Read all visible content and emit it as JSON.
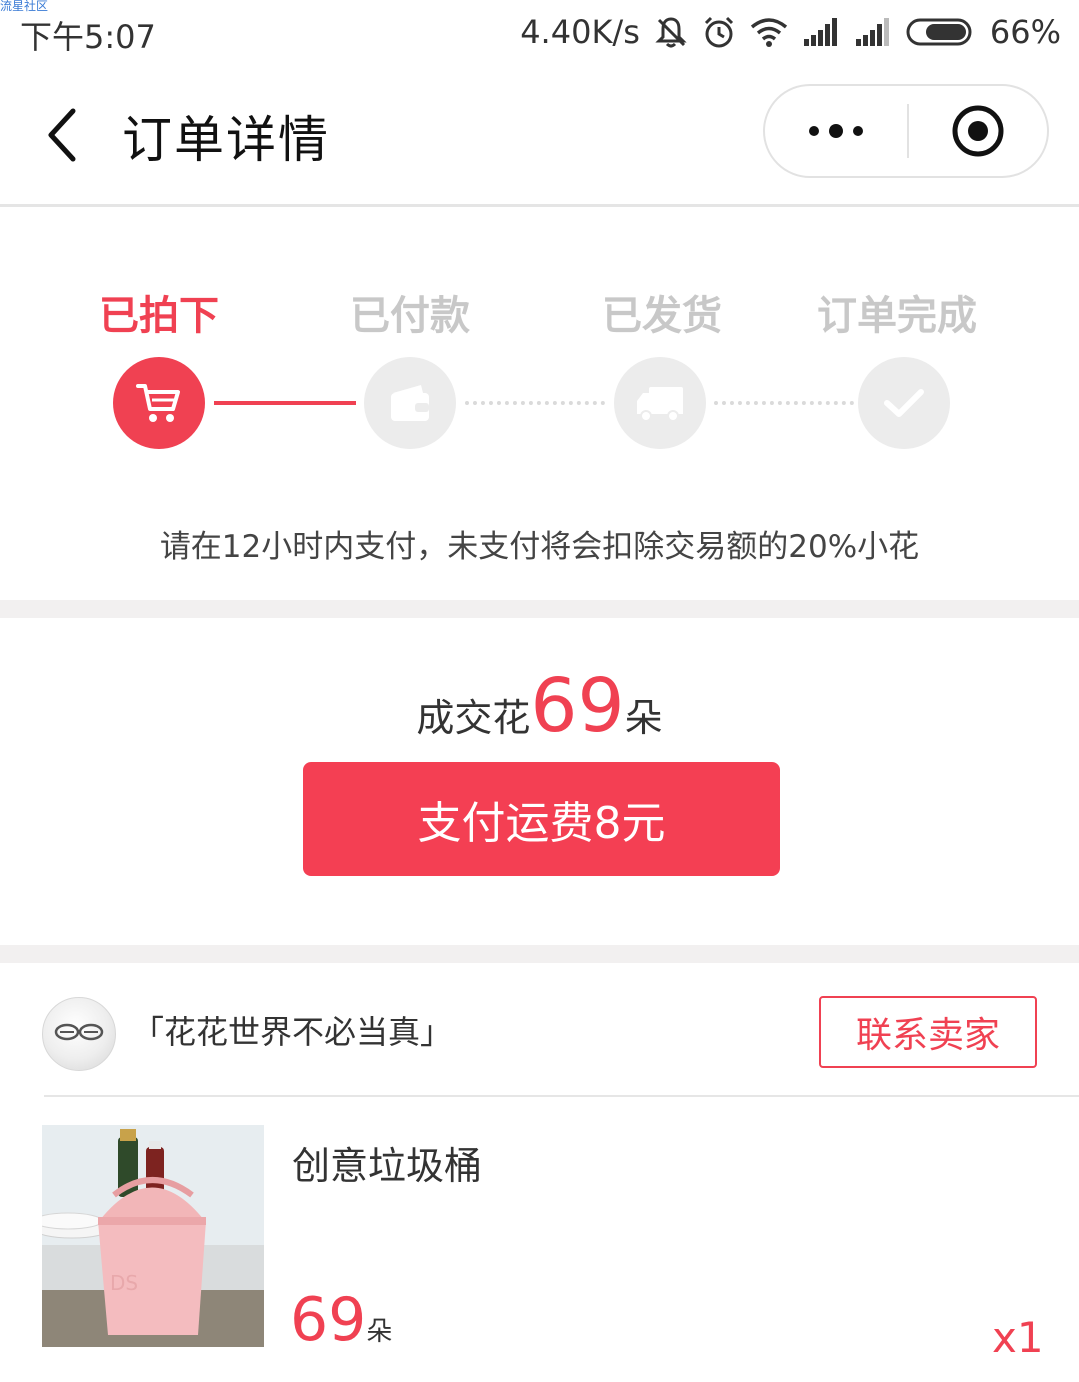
{
  "watermark": "流星社区",
  "status_bar": {
    "time": "下午5:07",
    "net_speed": "4.40K/s",
    "battery": "66%",
    "icons": [
      "mute-icon",
      "alarm-icon",
      "wifi-icon",
      "signal-icon",
      "signal-icon",
      "battery-icon"
    ]
  },
  "nav": {
    "title": "订单详情",
    "back_icon": "chevron-left-icon",
    "more_icon": "more-dots-icon",
    "close_icon": "target-icon"
  },
  "progress": {
    "current_step": 0,
    "steps": [
      {
        "label": "已拍下",
        "icon": "cart-icon"
      },
      {
        "label": "已付款",
        "icon": "wallet-icon"
      },
      {
        "label": "已发货",
        "icon": "truck-icon"
      },
      {
        "label": "订单完成",
        "icon": "check-icon"
      }
    ],
    "notice": "请在12小时内支付，未支付将会扣除交易额的20%小花"
  },
  "deal": {
    "prefix": "成交花",
    "amount": "69",
    "unit": "朵",
    "pay_button": "支付运费8元"
  },
  "seller": {
    "name": "「花花世界不必当真」",
    "contact_button": "联系卖家"
  },
  "product": {
    "name": "创意垃圾桶",
    "price": "69",
    "price_unit": "朵",
    "quantity": "x1"
  },
  "colors": {
    "accent": "#f04152",
    "inactive": "#ececec",
    "divider": "#f2f0f0"
  }
}
